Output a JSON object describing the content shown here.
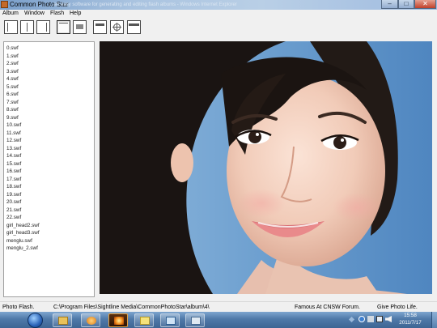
{
  "window": {
    "title": "Common Photo Star",
    "title_background_text": "... an easy software for generating and editing flash albums - Windows Internet Explorer",
    "controls": {
      "minimize": "–",
      "maximize": "□",
      "close": "✕"
    }
  },
  "menu": [
    "Album",
    "Window",
    "Flash",
    "Help"
  ],
  "toolbar": {
    "buttons": [
      "layout-list-icon",
      "layout-split-icon",
      "layout-right-panel-icon",
      "layout-single-icon",
      "layout-caption-icon",
      "frame-icon",
      "target-icon",
      "frame-wide-icon"
    ]
  },
  "files": [
    "0.swf",
    "1.swf",
    "2.swf",
    "3.swf",
    "4.swf",
    "5.swf",
    "6.swf",
    "7.swf",
    "8.swf",
    "9.swf",
    "10.swf",
    "11.swf",
    "12.swf",
    "13.swf",
    "14.swf",
    "15.swf",
    "16.swf",
    "17.swf",
    "18.swf",
    "19.swf",
    "20.swf",
    "21.swf",
    "22.swf",
    "girl_head2.swf",
    "girl_head3.swf",
    "menglu.swf",
    "menglu_2.swf"
  ],
  "status": {
    "left": "Photo Flash.",
    "path": "C:\\Program Files\\Sightline Media\\CommonPhotoStar\\album\\4\\",
    "forum": "Famous At CNSW Forum.",
    "tagline": "Give Photo Life."
  },
  "taskbar": {
    "time": "15:58",
    "date": "2011/7/17",
    "apps": [
      "explorer-folder-icon",
      "media-player-icon",
      "photo-star-icon",
      "notes-icon",
      "window-app-icon",
      "window-app-icon"
    ]
  },
  "colors": {
    "window_bg": "#f0f0f0",
    "taskbar": "#4f79a8",
    "photo_sky": "#7aa9d4"
  }
}
